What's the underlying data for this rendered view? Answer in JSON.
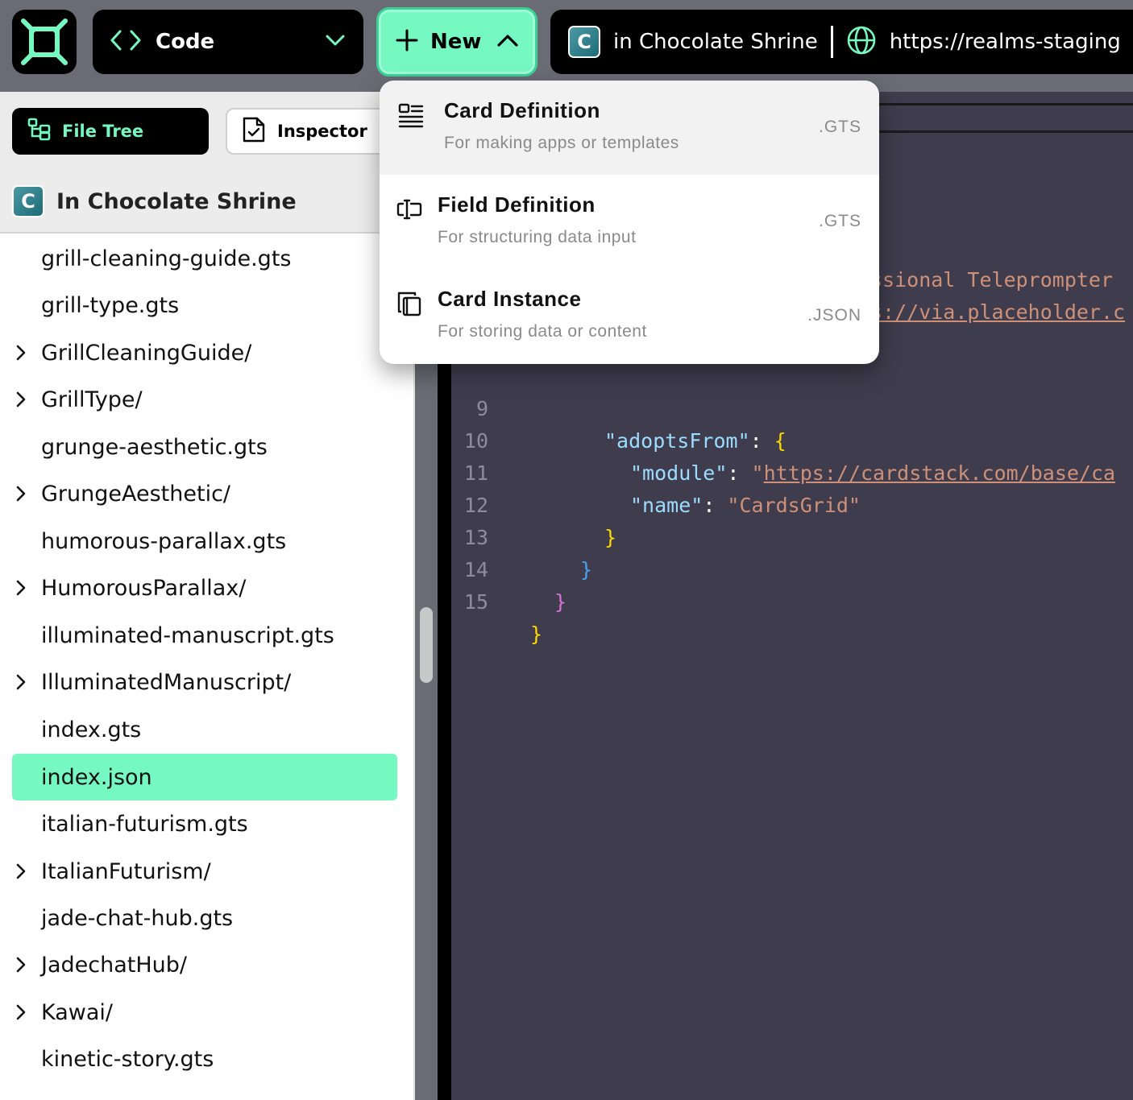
{
  "header": {
    "mode": {
      "label": "Code",
      "icon": "code-brackets-icon"
    },
    "new_button": {
      "label": "New",
      "icon": "plus-icon",
      "state": "expanded"
    },
    "realm": {
      "badge": "C",
      "name": "in Chocolate Shrine",
      "url": "https://realms-staging"
    }
  },
  "left_panel": {
    "tabs": [
      {
        "label": "File Tree",
        "icon": "file-tree-icon",
        "active": true
      },
      {
        "label": "Inspector",
        "icon": "file-check-icon",
        "active": false
      }
    ],
    "realm_header": {
      "badge": "C",
      "title": "In Chocolate Shrine"
    },
    "files": [
      {
        "name": "grill-cleaning-guide.gts",
        "folder": false
      },
      {
        "name": "grill-type.gts",
        "folder": false
      },
      {
        "name": "GrillCleaningGuide/",
        "folder": true
      },
      {
        "name": "GrillType/",
        "folder": true
      },
      {
        "name": "grunge-aesthetic.gts",
        "folder": false
      },
      {
        "name": "GrungeAesthetic/",
        "folder": true
      },
      {
        "name": "humorous-parallax.gts",
        "folder": false
      },
      {
        "name": "HumorousParallax/",
        "folder": true
      },
      {
        "name": "illuminated-manuscript.gts",
        "folder": false
      },
      {
        "name": "IlluminatedManuscript/",
        "folder": true
      },
      {
        "name": "index.gts",
        "folder": false
      },
      {
        "name": "index.json",
        "folder": false,
        "selected": true
      },
      {
        "name": "italian-futurism.gts",
        "folder": false
      },
      {
        "name": "ItalianFuturism/",
        "folder": true
      },
      {
        "name": "jade-chat-hub.gts",
        "folder": false
      },
      {
        "name": "JadechatHub/",
        "folder": true
      },
      {
        "name": "Kawai/",
        "folder": true
      },
      {
        "name": "kinetic-story.gts",
        "folder": false
      }
    ]
  },
  "editor": {
    "partial_lines": [
      "ssional Teleprompter",
      "s://via.placeholder.c"
    ],
    "lines": [
      {
        "n": "9",
        "key": "\"adoptsFrom\"",
        "after": ": ",
        "brace": "{"
      },
      {
        "n": "10",
        "key": "\"module\"",
        "after": ": ",
        "quote": "\"",
        "url": "https://cardstack.com/base/ca"
      },
      {
        "n": "11",
        "key": "\"name\"",
        "after": ": ",
        "value": "\"CardsGrid\""
      },
      {
        "n": "12",
        "brace": "}"
      },
      {
        "n": "13",
        "brace": "}"
      },
      {
        "n": "14",
        "brace": "}"
      },
      {
        "n": "15",
        "brace": "}"
      }
    ]
  },
  "new_menu": {
    "items": [
      {
        "title": "Card Definition",
        "description": "For making apps or templates",
        "ext": ".GTS",
        "icon": "card-definition-icon"
      },
      {
        "title": "Field Definition",
        "description": "For structuring data input",
        "ext": ".GTS",
        "icon": "field-definition-icon"
      },
      {
        "title": "Card Instance",
        "description": "For storing data or content",
        "ext": ".JSON",
        "icon": "card-instance-icon"
      }
    ]
  },
  "colors": {
    "accent": "#76f9c0",
    "editor_bg": "#3f3c4d",
    "chrome_bg": "#6b6b75"
  }
}
